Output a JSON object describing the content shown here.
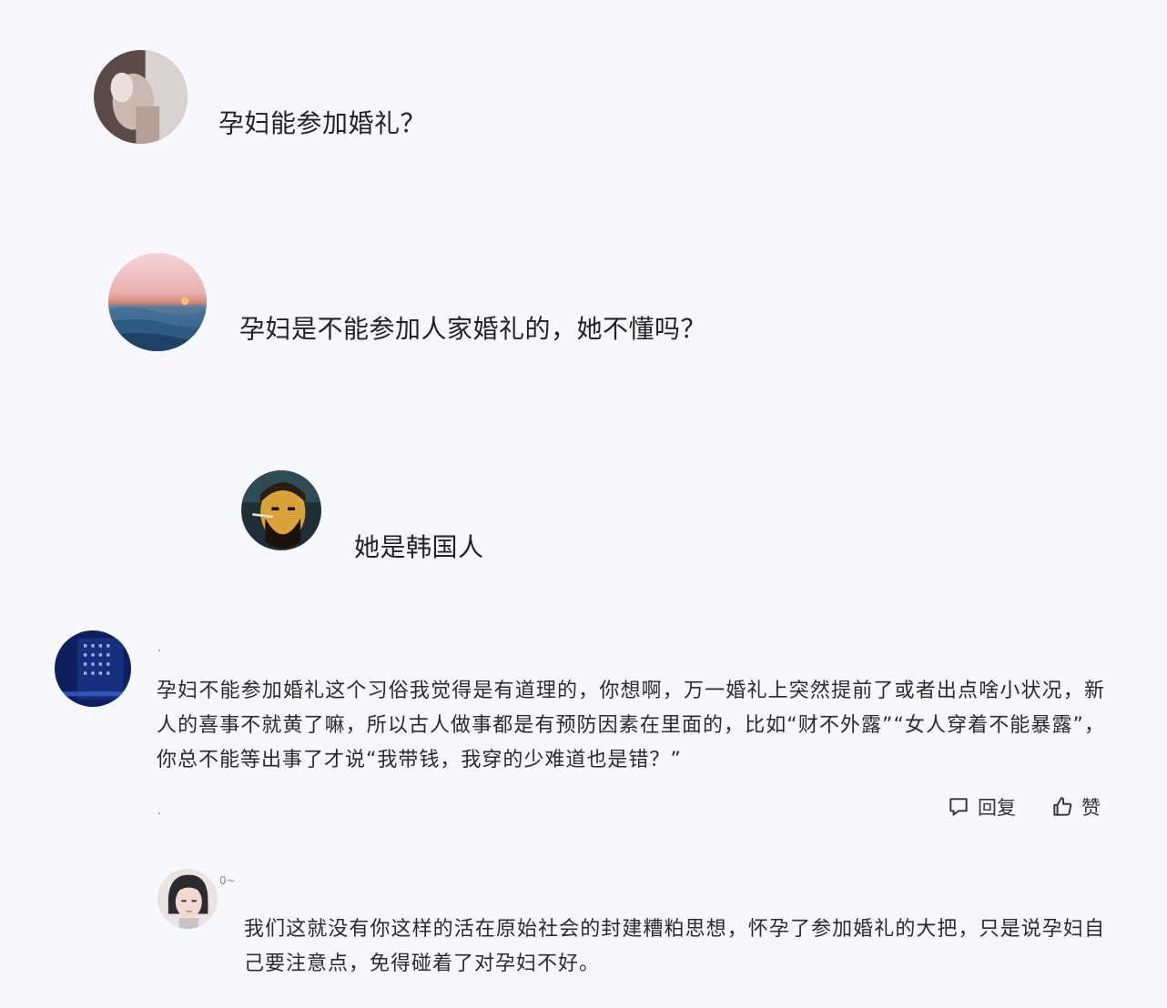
{
  "comments": [
    {
      "text": "孕妇能参加婚礼？",
      "avatar": "woman-photo-avatar"
    },
    {
      "text": "孕妇是不能参加人家婚礼的，她不懂吗？",
      "avatar": "sunset-sea-avatar"
    },
    {
      "text": "她是韩国人",
      "avatar": "bearded-man-avatar"
    },
    {
      "text": "孕妇不能参加婚礼这个习俗我觉得是有道理的，你想啊，万一婚礼上突然提前了或者出点啥小状况，新人的喜事不就黄了嘛，所以古人做事都是有预防因素在里面的，比如“财不外露”“女人穿着不能暴露”，你总不能等出事了才说“我带钱，我穿的少难道也是错？”",
      "avatar": "night-city-avatar",
      "actions": {
        "reply": "回复",
        "like": "赞"
      }
    },
    {
      "username": "0~",
      "text": "我们这就没有你这样的活在原始社会的封建糟粕思想，怀孕了参加婚礼的大把，只是说孕妇自己要注意点，免得碰着了对孕妇不好。",
      "avatar": "girl-portrait-avatar"
    }
  ],
  "colors": {
    "background": "#f7f8fc",
    "text": "#222222",
    "icon": "#333333"
  }
}
